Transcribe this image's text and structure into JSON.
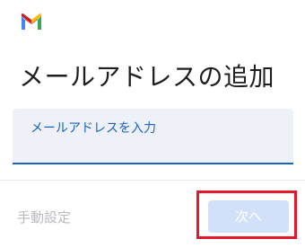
{
  "header": {
    "logo_icon": "gmail-logo-icon",
    "title": "メールアドレスの追加"
  },
  "email_field": {
    "label": "メールアドレスを入力",
    "value": ""
  },
  "footer": {
    "manual_setup_label": "手動設定",
    "next_label": "次へ"
  },
  "colors": {
    "accent": "#1a63c2",
    "field_background": "#eef2f8",
    "next_button_disabled": "#d2e1f9",
    "highlight": "#e0192b"
  }
}
